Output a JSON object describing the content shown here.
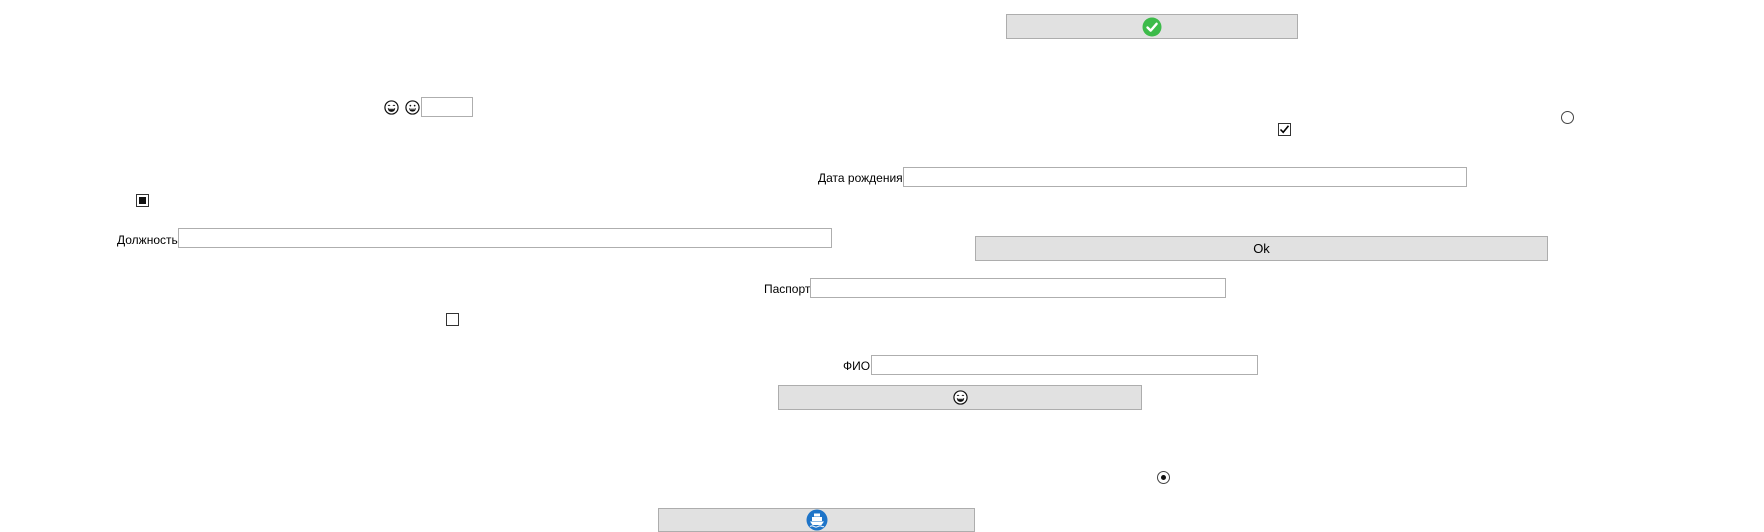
{
  "buttons": {
    "check_button_icon": "check-circle-icon",
    "ok_label": "Ok",
    "emoji_button_icon": "grinning-face-icon",
    "ship_button_icon": "ship-icon"
  },
  "labels": {
    "position": "Должность",
    "birth_date": "Дата рождения",
    "passport": "Паспорт",
    "full_name": "ФИО"
  },
  "fields": {
    "small_value": "",
    "position_value": "",
    "birth_date_value": "",
    "passport_value": "",
    "full_name_value": ""
  },
  "controls": {
    "checkbox_checked": true,
    "checkbox_unchecked": false,
    "checkbox_indeterminate": "indeterminate",
    "radio_top_selected": false,
    "radio_bottom_selected": true
  },
  "colors": {
    "button_bg": "#e1e1e1",
    "check_green": "#3dbb4a",
    "ship_blue": "#1e74c8"
  }
}
